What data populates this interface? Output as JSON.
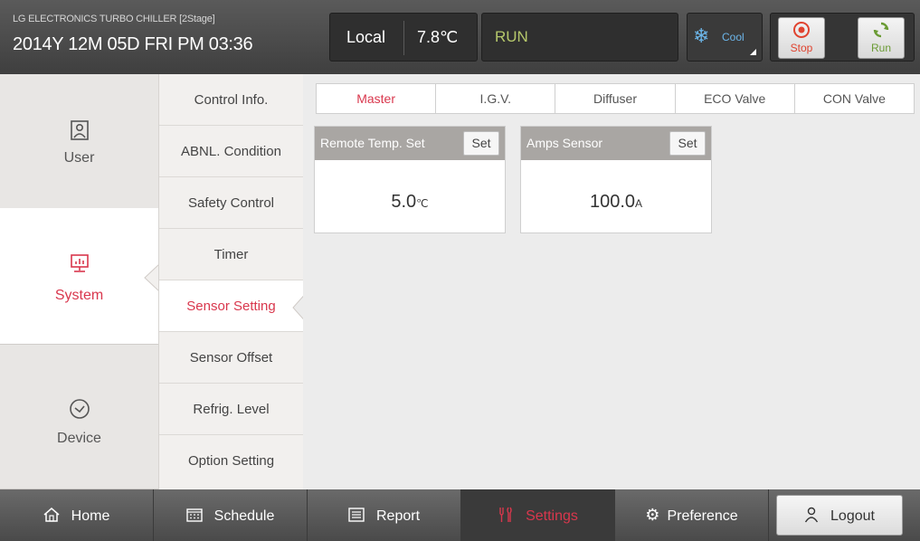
{
  "header": {
    "brand": "LG ELECTRONICS TURBO CHILLER [2Stage]",
    "datetime": "2014Y 12M 05D  FRI PM 03:36",
    "mode": "Local",
    "temperature": "7.8℃",
    "status": "RUN",
    "operation_mode": "Cool",
    "stop_label": "Stop",
    "run_label": "Run",
    "icons": {
      "cool": "snowflake-icon",
      "stop": "stop-icon",
      "run": "refresh-icon"
    },
    "colors": {
      "status": "#b6c86b",
      "cool": "#6cb6ea",
      "stop": "#e0432f",
      "run": "#6a9b34"
    }
  },
  "left_nav": {
    "items": [
      {
        "label": "User",
        "icon": "user-icon"
      },
      {
        "label": "System",
        "icon": "monitor-chart-icon"
      },
      {
        "label": "Device",
        "icon": "check-circle-icon"
      }
    ],
    "active": "System",
    "accent": "#d9374d"
  },
  "sub_menu": {
    "items": [
      "Control Info.",
      "ABNL. Condition",
      "Safety Control",
      "Timer",
      "Sensor Setting",
      "Sensor Offset",
      "Refrig. Level",
      "Option Setting"
    ],
    "active": "Sensor Setting"
  },
  "main": {
    "tabs": [
      "Master",
      "I.G.V.",
      "Diffuser",
      "ECO Valve",
      "CON Valve"
    ],
    "active_tab": "Master",
    "cards": [
      {
        "title": "Remote Temp. Set",
        "set_label": "Set",
        "value": "5.0",
        "unit": "℃"
      },
      {
        "title": "Amps Sensor",
        "set_label": "Set",
        "value": "100.0",
        "unit": "A"
      }
    ]
  },
  "bottom_nav": {
    "items": [
      {
        "label": "Home",
        "icon": "home-icon"
      },
      {
        "label": "Schedule",
        "icon": "calendar-icon"
      },
      {
        "label": "Report",
        "icon": "list-icon"
      },
      {
        "label": "Settings",
        "icon": "tools-icon"
      },
      {
        "label": "Preference",
        "icon": "gear-icon"
      },
      {
        "label": "Logout",
        "icon": "person-icon"
      }
    ],
    "active": "Settings"
  }
}
